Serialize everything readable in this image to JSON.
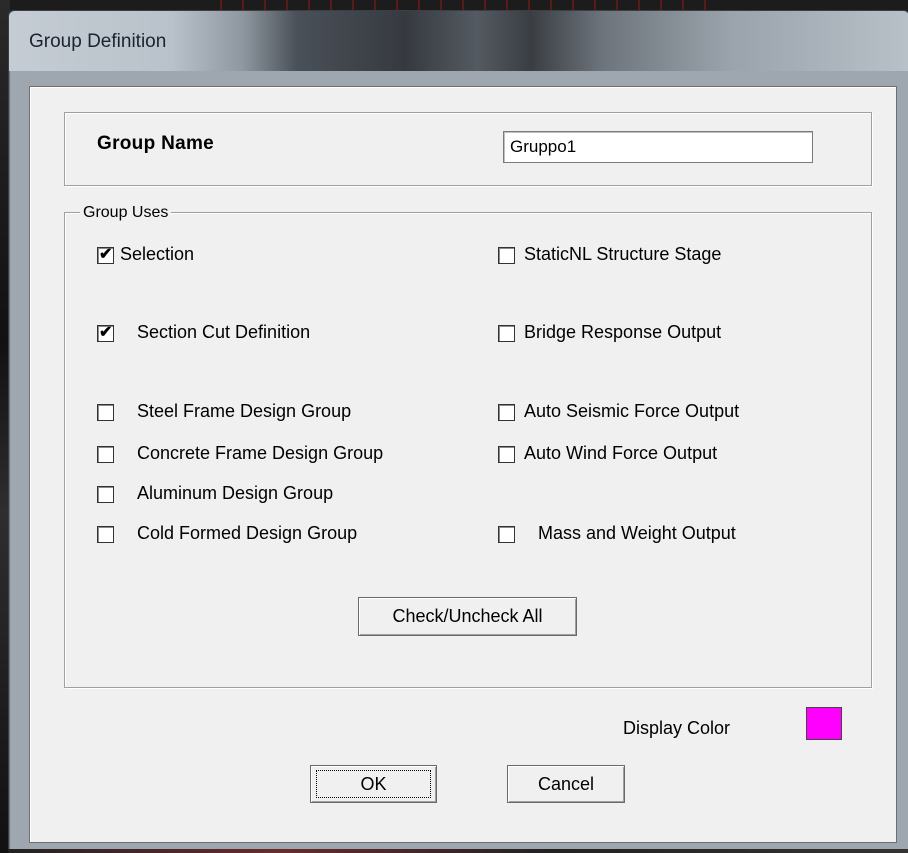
{
  "window": {
    "title": "Group Definition"
  },
  "group_name": {
    "label": "Group Name",
    "value": "Gruppo1"
  },
  "group_uses": {
    "legend": "Group Uses",
    "items": [
      {
        "label": "Selection",
        "checked": true
      },
      {
        "label": "StaticNL Structure Stage",
        "checked": false
      },
      {
        "label": "Section Cut Definition",
        "checked": true
      },
      {
        "label": "Bridge Response Output",
        "checked": false
      },
      {
        "label": "Steel Frame Design Group",
        "checked": false
      },
      {
        "label": "Auto Seismic Force Output",
        "checked": false
      },
      {
        "label": "Concrete Frame Design Group",
        "checked": false
      },
      {
        "label": "Auto Wind Force Output",
        "checked": false
      },
      {
        "label": "Aluminum Design Group",
        "checked": false
      },
      {
        "label": "Cold Formed Design Group",
        "checked": false
      },
      {
        "label": "Mass and Weight Output",
        "checked": false
      }
    ],
    "check_all_label": "Check/Uncheck All"
  },
  "display_color": {
    "label": "Display Color",
    "color": "#ff00ff"
  },
  "buttons": {
    "ok_label": "OK",
    "cancel_label": "Cancel"
  }
}
